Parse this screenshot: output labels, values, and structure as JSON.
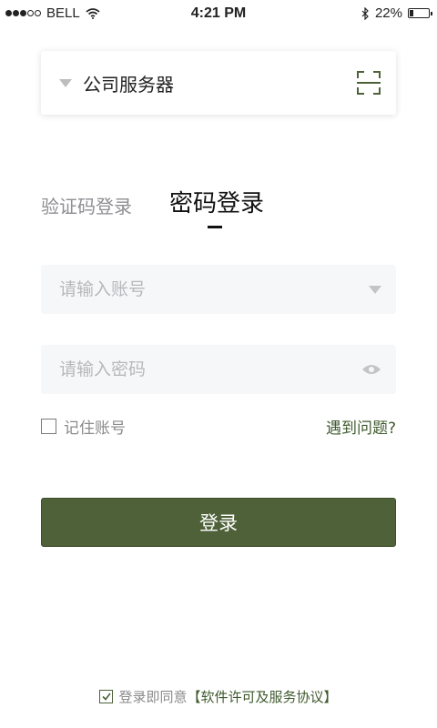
{
  "status_bar": {
    "carrier": "BELL",
    "time": "4:21 PM",
    "battery": "22%",
    "battery_level": 0.22
  },
  "server": {
    "name": "公司服务器",
    "icons": {
      "dropdown": "caret-down-icon",
      "scan": "scan-icon"
    }
  },
  "tabs": {
    "sms_login": "验证码登录",
    "password_login": "密码登录",
    "active": "password_login"
  },
  "form": {
    "account_placeholder": "请输入账号",
    "password_placeholder": "请输入密码",
    "account_value": "",
    "password_value": ""
  },
  "remember": {
    "label": "记住账号",
    "checked": false
  },
  "problem_link": "遇到问题?",
  "login_button": "登录",
  "agreement": {
    "checked": true,
    "prefix": "登录即同意",
    "link": "【软件许可及服务协议】"
  },
  "colors": {
    "accent": "#4e6138",
    "link": "#3f5a2e",
    "placeholder": "#b7b8bc"
  }
}
